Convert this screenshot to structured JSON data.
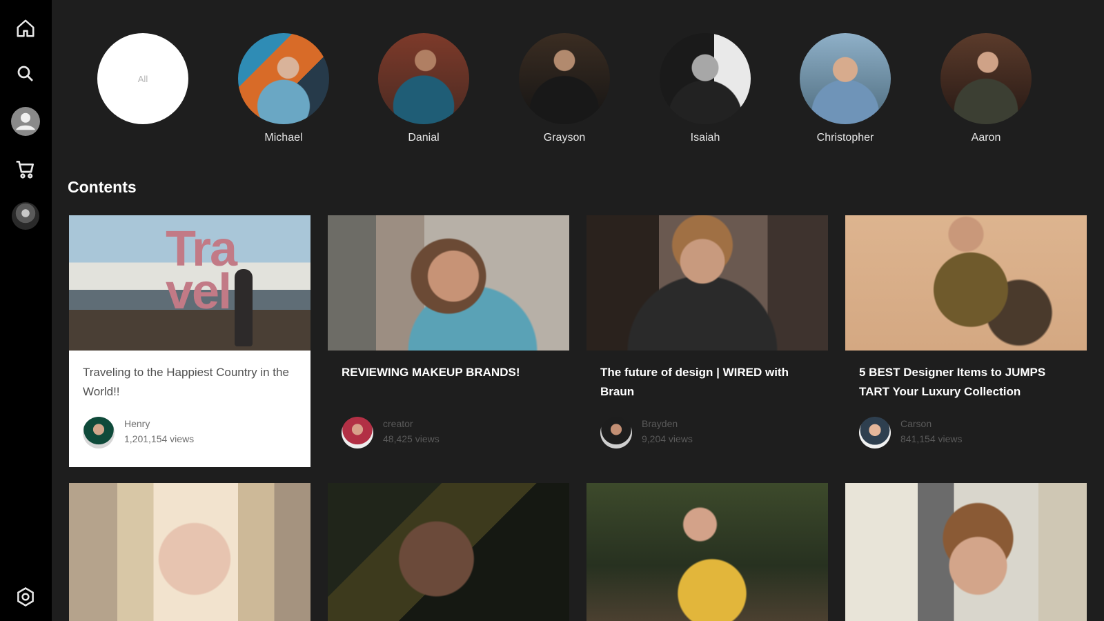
{
  "sidebar": {
    "items": [
      {
        "name": "home",
        "icon": "home-icon"
      },
      {
        "name": "search",
        "icon": "search-icon"
      },
      {
        "name": "profile",
        "icon": "user-icon"
      },
      {
        "name": "cart",
        "icon": "cart-icon"
      },
      {
        "name": "avatar",
        "icon": "avatar"
      },
      {
        "name": "settings",
        "icon": "settings-icon"
      }
    ]
  },
  "creators": {
    "all_label": "All",
    "names": [
      "Michael",
      "Danial",
      "Grayson",
      "Isaiah",
      "Christopher",
      "Aaron"
    ]
  },
  "contents": {
    "title": "Contents",
    "thumb_text": "Tra vel",
    "cards": [
      {
        "title": "Traveling to the Happiest Country  in the World!!",
        "author": "Henry",
        "views": "1,201,154 views"
      },
      {
        "title": "REVIEWING MAKEUP BRANDS!",
        "author": "creator",
        "views": "48,425 views"
      },
      {
        "title": "The future of design | WIRED with Braun",
        "author": "Brayden",
        "views": "9,204 views"
      },
      {
        "title": "5 BEST Designer Items to JUMPS TART Your Luxury Collection",
        "author": "Carson",
        "views": "841,154 views"
      }
    ]
  },
  "colors": {
    "background": "#1e1e1e",
    "sidebar": "#000000",
    "text": "#ffffff",
    "muted": "#5a5a5a"
  }
}
